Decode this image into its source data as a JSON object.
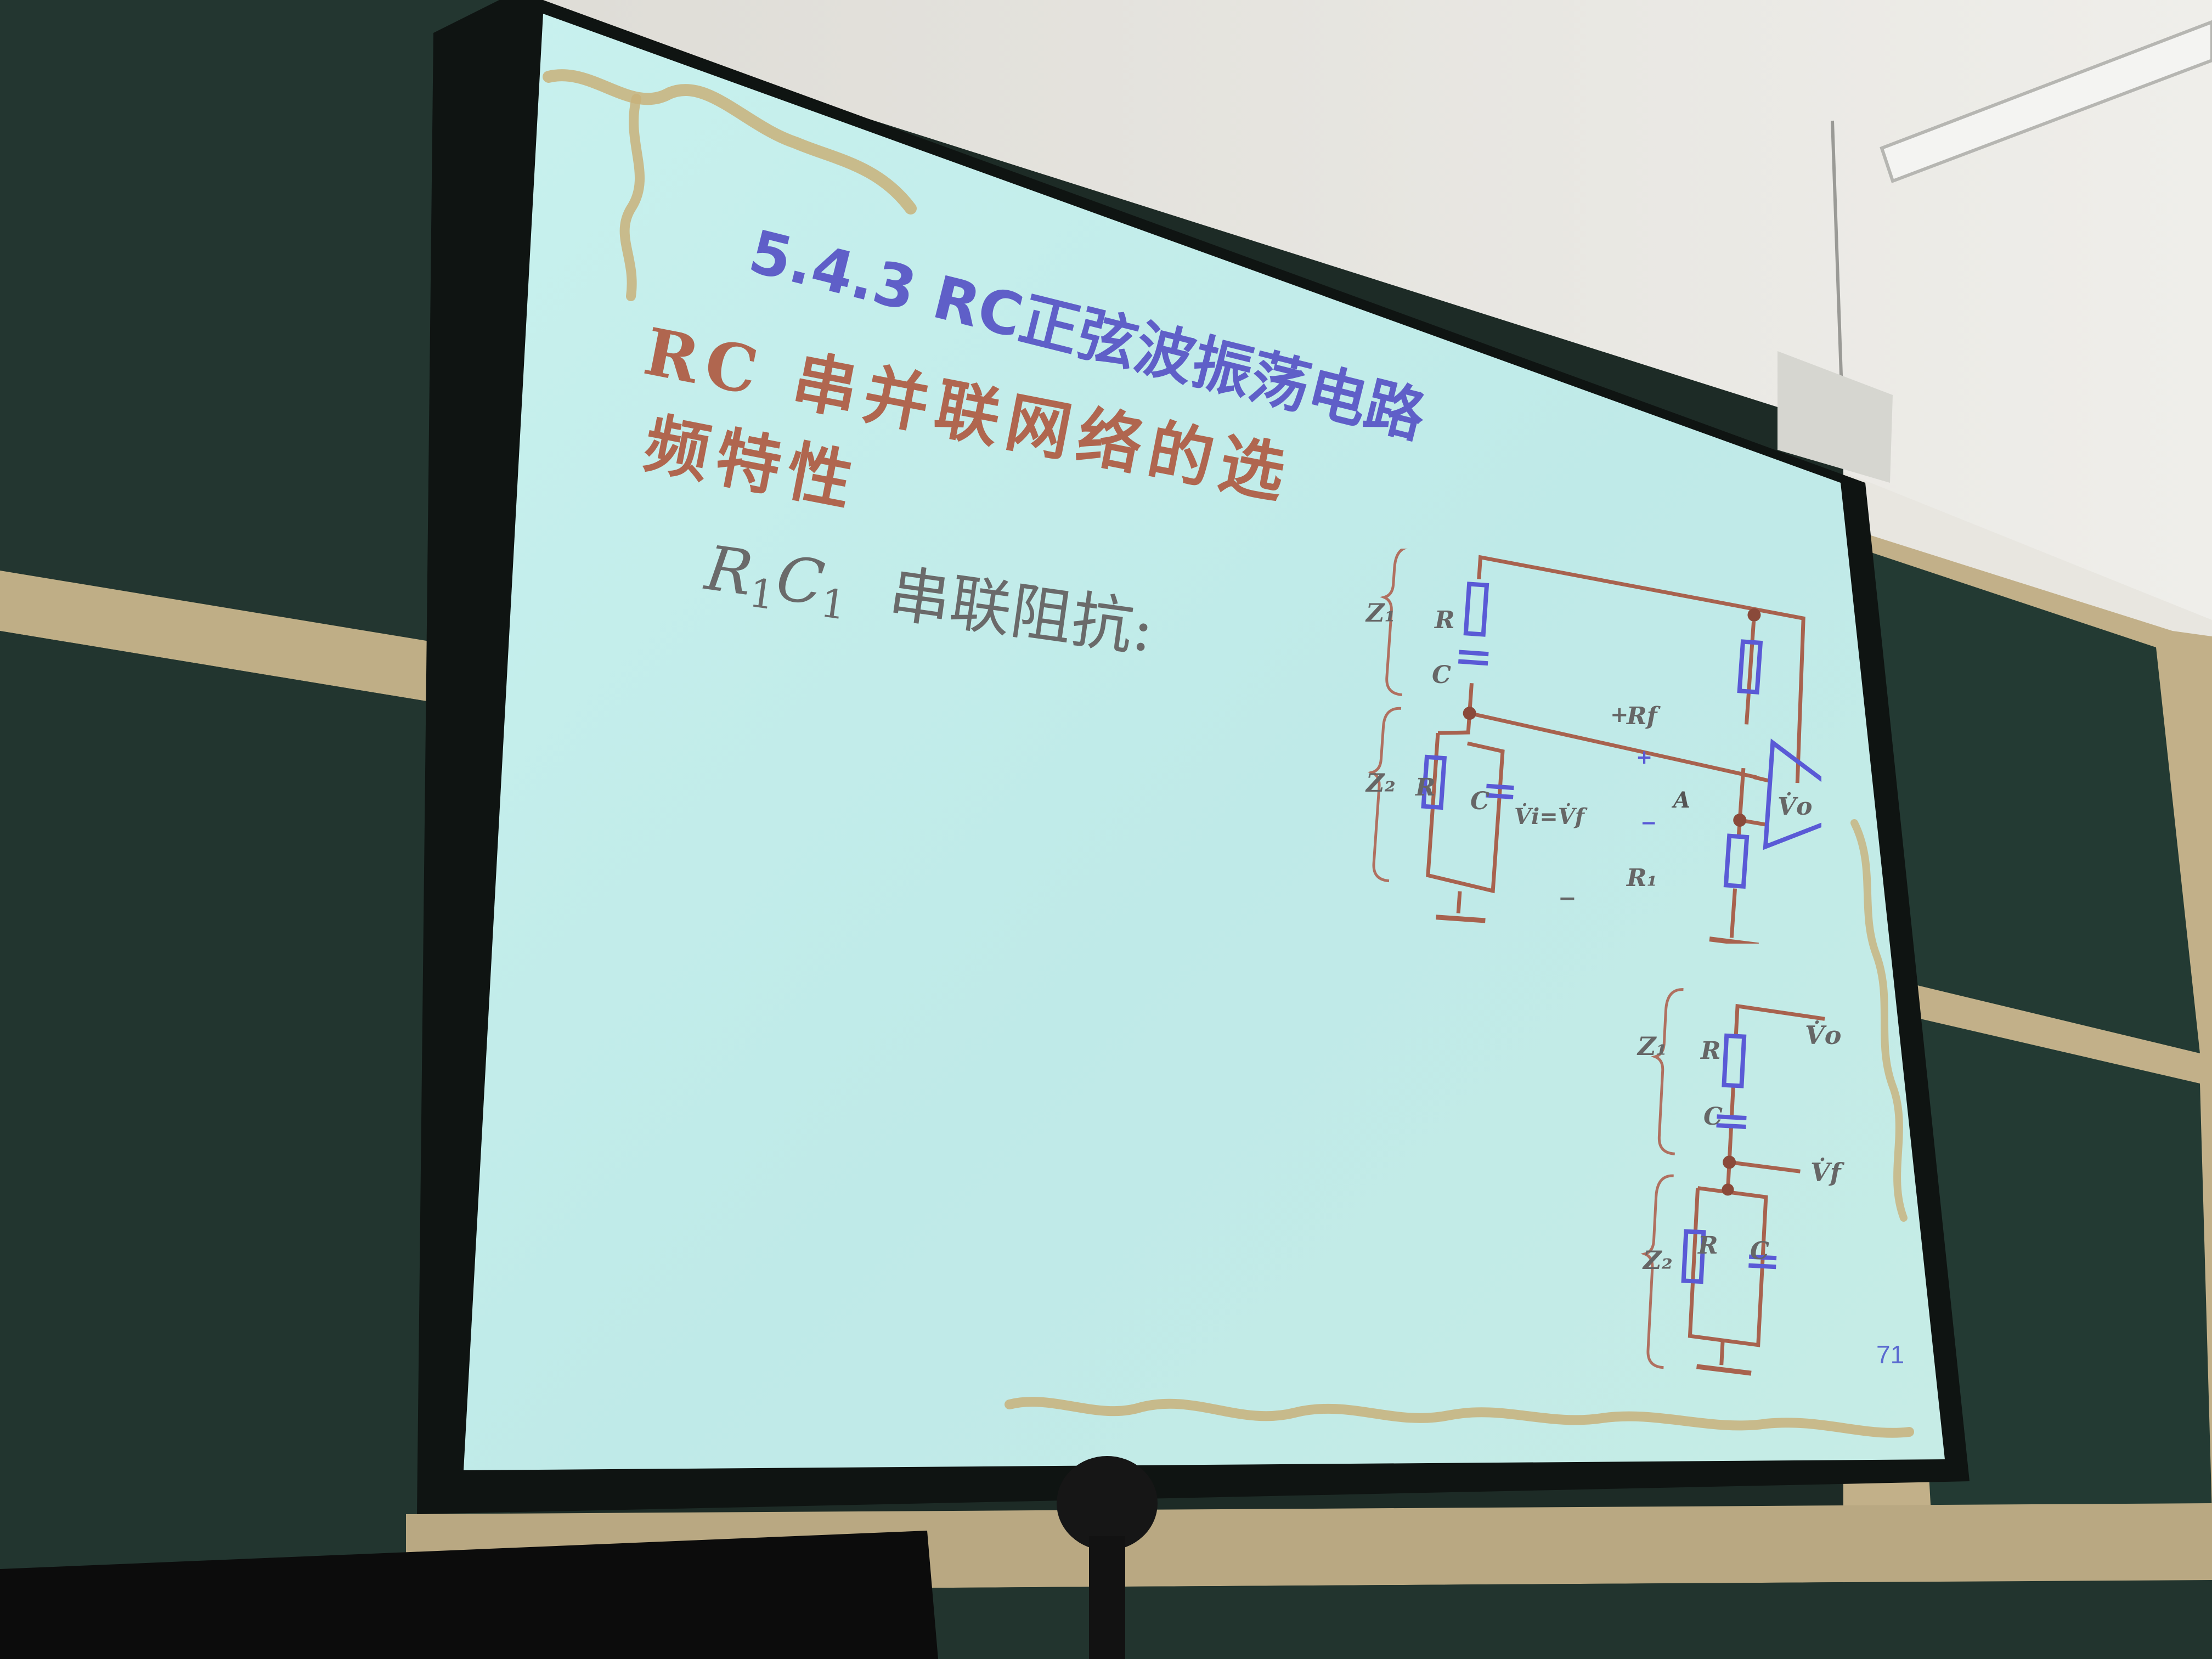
{
  "slide": {
    "title": "5.4.3  RC正弦波振荡电路",
    "heading_line1": "RC 串并联网络的选",
    "heading_line2": "频特性",
    "formula_r": "R",
    "formula_r_sub": "1",
    "formula_c": "C",
    "formula_c_sub": "1",
    "formula_text": "串联阻抗:",
    "page_number": "71"
  },
  "circuit_top": {
    "z1": "Z₁",
    "z2": "Z₂",
    "r_upper": "R",
    "c_upper": "C",
    "r_lower": "R",
    "c_lower": "C",
    "rf": "Rf",
    "r1": "R₁",
    "amp": "A",
    "plus_in": "+",
    "minus_in": "−",
    "vi_eq_vf": "V̇i=V̇f",
    "plus_node": "+",
    "minus_node": "−",
    "vo": "V̇o"
  },
  "circuit_bottom": {
    "z1": "Z₁",
    "z2": "Z₂",
    "r_upper": "R",
    "c_upper": "C",
    "r_lower": "R",
    "c_lower": "C",
    "vo": "V̇o",
    "vf": "V̇f"
  },
  "colors": {
    "slide_bg": "#bfeae8",
    "title": "#5f5fc8",
    "heading": "#b0664f",
    "wire": "#a8624e",
    "component": "#5a5ad6",
    "chalkboard": "#24362f",
    "wall": "#e7e6e1"
  }
}
